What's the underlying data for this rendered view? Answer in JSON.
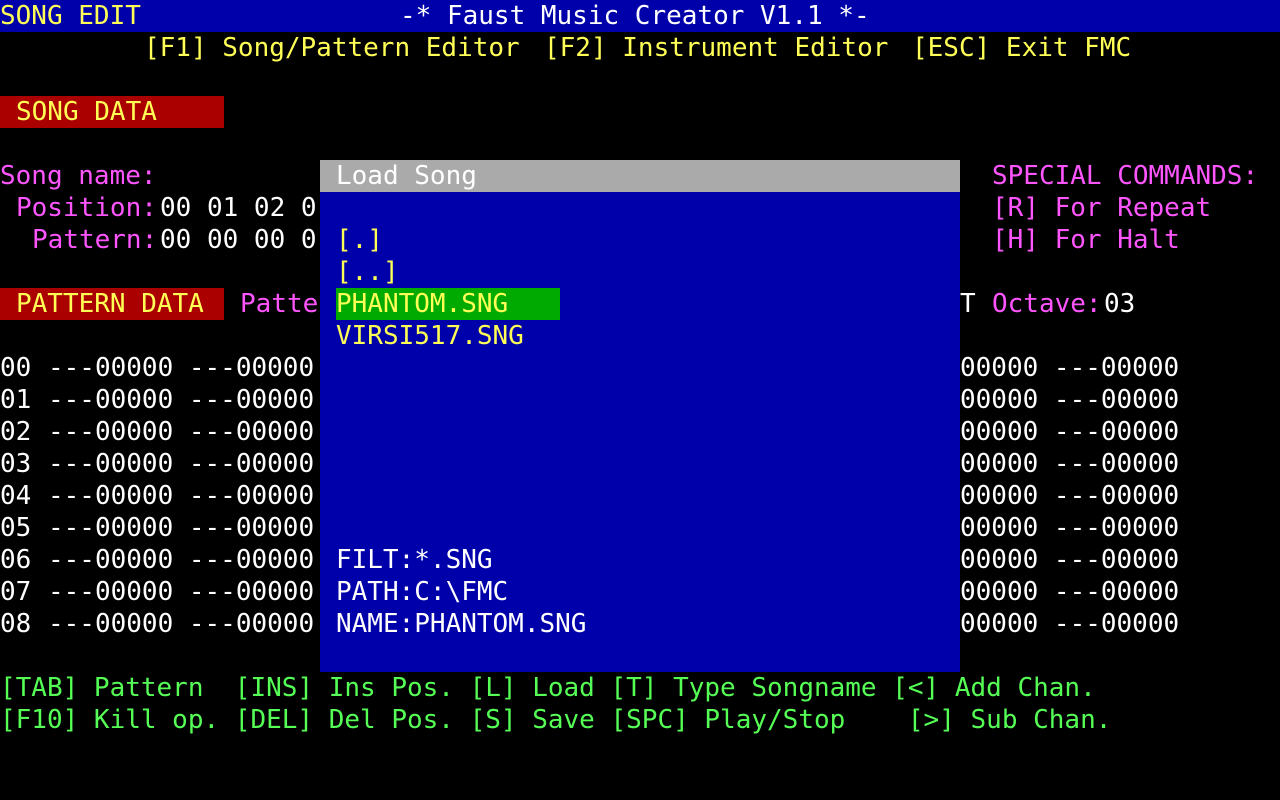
{
  "header": {
    "mode": "SONG EDIT",
    "title": "-* Faust Music Creator V1.1 *-"
  },
  "menu": {
    "f1": "[F1] Song/Pattern Editor",
    "f2": "[F2] Instrument Editor",
    "esc": "[ESC] Exit FMC"
  },
  "song_data": {
    "heading": "SONG DATA",
    "name_label": "Song name:",
    "position_label": "Position:",
    "position_values": "00 01 02 0",
    "pattern_label": "Pattern:",
    "pattern_values": "00 00 00 0"
  },
  "special_commands": {
    "heading": "SPECIAL COMMANDS:",
    "repeat": "[R] For Repeat",
    "halt": "[H] For Halt"
  },
  "pattern_data": {
    "heading": "PATTERN DATA",
    "pattern_label_partial": "Patte",
    "right_partial": "T",
    "octave_label": "Octave:",
    "octave_value": "03",
    "rows": [
      {
        "index": "00",
        "left": "---00000 ---00000",
        "right": "00000 ---00000"
      },
      {
        "index": "01",
        "left": "---00000 ---00000",
        "right": "00000 ---00000"
      },
      {
        "index": "02",
        "left": "---00000 ---00000",
        "right": "00000 ---00000"
      },
      {
        "index": "03",
        "left": "---00000 ---00000",
        "right": "00000 ---00000"
      },
      {
        "index": "04",
        "left": "---00000 ---00000",
        "right": "00000 ---00000"
      },
      {
        "index": "05",
        "left": "---00000 ---00000",
        "right": "00000 ---00000"
      },
      {
        "index": "06",
        "left": "---00000 ---00000",
        "right": "00000 ---00000"
      },
      {
        "index": "07",
        "left": "---00000 ---00000",
        "right": "00000 ---00000"
      },
      {
        "index": "08",
        "left": "---00000 ---00000",
        "right": "00000 ---00000"
      }
    ]
  },
  "dialog": {
    "title": "Load Song",
    "files": [
      "[.]",
      "[..]",
      "PHANTOM.SNG",
      "VIRSI517.SNG"
    ],
    "selected_index": 2,
    "filter": "FILT:*.SNG",
    "path": "PATH:C:\\FMC",
    "name": "NAME:PHANTOM.SNG"
  },
  "help": {
    "line1": "[TAB] Pattern  [INS] Ins Pos. [L] Load [T] Type Songname [<] Add Chan.",
    "line2": "[F10] Kill op. [DEL] Del Pos. [S] Save [SPC] Play/Stop    [>] Sub Chan."
  },
  "colors": {
    "background": "#000000",
    "title_bar": "#0000aa",
    "dialog_bg": "#0000aa",
    "dialog_title": "#aaaaaa",
    "selection": "#00aa00",
    "section_heading_bg": "#aa0000",
    "yellow_text": "#ffff55",
    "magenta_text": "#ff55ff",
    "green_text": "#55ff55"
  }
}
